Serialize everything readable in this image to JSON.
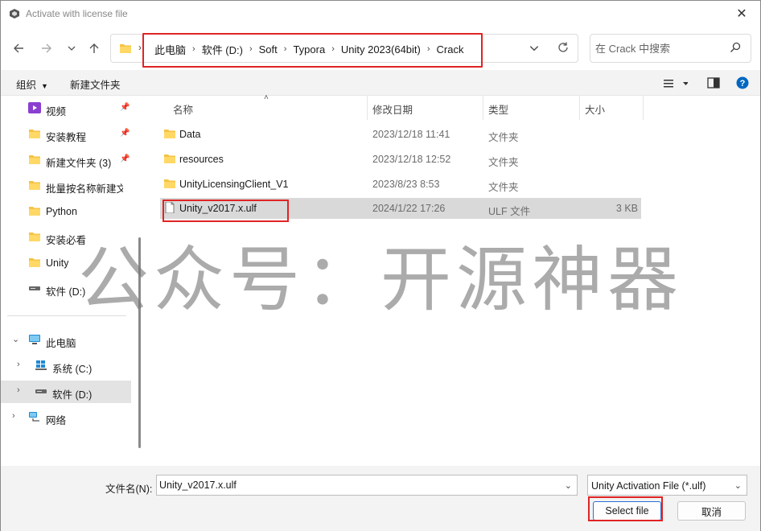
{
  "window": {
    "title": "Activate with license file",
    "close_glyph": "✕"
  },
  "address_bar": {
    "breadcrumbs": [
      "此电脑",
      "软件 (D:)",
      "Soft",
      "Typora",
      "Unity 2023(64bit)",
      "Crack"
    ],
    "search_placeholder": "在 Crack 中搜索"
  },
  "toolbar": {
    "organize_label": "组织",
    "new_folder_label": "新建文件夹"
  },
  "sidebar": {
    "quick_access": [
      {
        "label": "视频",
        "icon": "video-folder-icon",
        "pinned": true
      },
      {
        "label": "安装教程",
        "icon": "folder-icon",
        "pinned": true
      },
      {
        "label": "新建文件夹 (3)",
        "icon": "folder-icon",
        "pinned": true
      },
      {
        "label": "批量按名称新建文",
        "icon": "folder-icon",
        "pinned": false
      },
      {
        "label": "Python",
        "icon": "folder-icon",
        "pinned": false
      },
      {
        "label": "安装必看",
        "icon": "folder-icon",
        "pinned": false
      },
      {
        "label": "Unity",
        "icon": "folder-icon",
        "pinned": false
      },
      {
        "label": "软件 (D:)",
        "icon": "drive-icon",
        "pinned": false
      }
    ],
    "tree": [
      {
        "label": "此电脑",
        "icon": "computer-icon",
        "expanded": true
      },
      {
        "label": "系统 (C:)",
        "icon": "windows-drive-icon",
        "expanded": false
      },
      {
        "label": "软件 (D:)",
        "icon": "drive-icon",
        "expanded": false,
        "selected": true
      },
      {
        "label": "网络",
        "icon": "network-icon",
        "expanded": false
      }
    ]
  },
  "file_list": {
    "columns": [
      "名称",
      "修改日期",
      "类型",
      "大小"
    ],
    "rows": [
      {
        "name": "Data",
        "date": "2023/12/18 11:41",
        "type": "文件夹",
        "size": "",
        "kind": "folder"
      },
      {
        "name": "resources",
        "date": "2023/12/18 12:52",
        "type": "文件夹",
        "size": "",
        "kind": "folder"
      },
      {
        "name": "UnityLicensingClient_V1",
        "date": "2023/8/23 8:53",
        "type": "文件夹",
        "size": "",
        "kind": "folder"
      },
      {
        "name": "Unity_v2017.x.ulf",
        "date": "2024/1/22 17:26",
        "type": "ULF 文件",
        "size": "3 KB",
        "kind": "file",
        "selected": true
      }
    ]
  },
  "watermark": "公众号：开源神器",
  "bottom": {
    "file_name_label": "文件名(N):",
    "file_name_value": "Unity_v2017.x.ulf",
    "filter_value": "Unity Activation File (*.ulf)",
    "select_button": "Select file",
    "cancel_button": "取消"
  },
  "colors": {
    "highlight_red": "#e02424",
    "folder_yellow": "#f5c342",
    "selection_gray": "#d9d9d9",
    "accent_blue": "#0067c0"
  }
}
